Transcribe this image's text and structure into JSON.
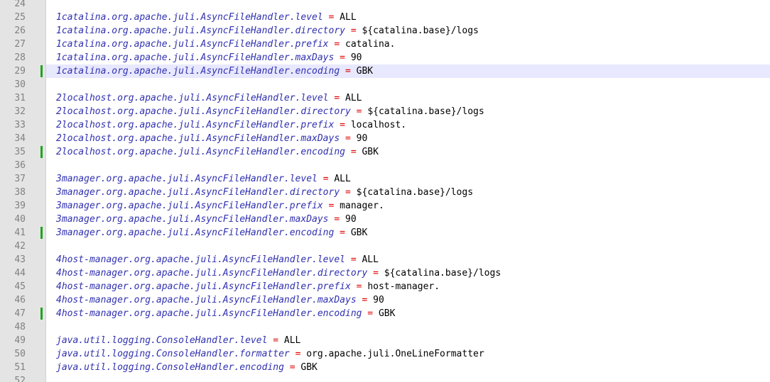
{
  "editor": {
    "language": "properties",
    "colors": {
      "gutter_bg": "#e4e4e4",
      "key": "#3030b0",
      "operator": "#e00000",
      "value": "#000000",
      "current_line": "#e8e8ff",
      "change_marker": "#1ea51e"
    },
    "current_line": 29,
    "lines": [
      {
        "num": "24",
        "key": "",
        "op": "",
        "value": "",
        "changed": false
      },
      {
        "num": "25",
        "key": "1catalina.org.apache.juli.AsyncFileHandler.level",
        "op": "=",
        "value": "ALL",
        "changed": false
      },
      {
        "num": "26",
        "key": "1catalina.org.apache.juli.AsyncFileHandler.directory",
        "op": "=",
        "value": "${catalina.base}/logs",
        "changed": false
      },
      {
        "num": "27",
        "key": "1catalina.org.apache.juli.AsyncFileHandler.prefix",
        "op": "=",
        "value": "catalina.",
        "changed": false
      },
      {
        "num": "28",
        "key": "1catalina.org.apache.juli.AsyncFileHandler.maxDays",
        "op": "=",
        "value": "90",
        "changed": false
      },
      {
        "num": "29",
        "key": "1catalina.org.apache.juli.AsyncFileHandler.encoding",
        "op": "=",
        "value": "GBK",
        "changed": true
      },
      {
        "num": "30",
        "key": "",
        "op": "",
        "value": "",
        "changed": false
      },
      {
        "num": "31",
        "key": "2localhost.org.apache.juli.AsyncFileHandler.level",
        "op": "=",
        "value": "ALL",
        "changed": false
      },
      {
        "num": "32",
        "key": "2localhost.org.apache.juli.AsyncFileHandler.directory",
        "op": "=",
        "value": "${catalina.base}/logs",
        "changed": false
      },
      {
        "num": "33",
        "key": "2localhost.org.apache.juli.AsyncFileHandler.prefix",
        "op": "=",
        "value": "localhost.",
        "changed": false
      },
      {
        "num": "34",
        "key": "2localhost.org.apache.juli.AsyncFileHandler.maxDays",
        "op": "=",
        "value": "90",
        "changed": false
      },
      {
        "num": "35",
        "key": "2localhost.org.apache.juli.AsyncFileHandler.encoding",
        "op": "=",
        "value": "GBK",
        "changed": true
      },
      {
        "num": "36",
        "key": "",
        "op": "",
        "value": "",
        "changed": false
      },
      {
        "num": "37",
        "key": "3manager.org.apache.juli.AsyncFileHandler.level",
        "op": "=",
        "value": "ALL",
        "changed": false
      },
      {
        "num": "38",
        "key": "3manager.org.apache.juli.AsyncFileHandler.directory",
        "op": "=",
        "value": "${catalina.base}/logs",
        "changed": false
      },
      {
        "num": "39",
        "key": "3manager.org.apache.juli.AsyncFileHandler.prefix",
        "op": "=",
        "value": "manager.",
        "changed": false
      },
      {
        "num": "40",
        "key": "3manager.org.apache.juli.AsyncFileHandler.maxDays",
        "op": "=",
        "value": "90",
        "changed": false
      },
      {
        "num": "41",
        "key": "3manager.org.apache.juli.AsyncFileHandler.encoding",
        "op": "=",
        "value": "GBK",
        "changed": true
      },
      {
        "num": "42",
        "key": "",
        "op": "",
        "value": "",
        "changed": false
      },
      {
        "num": "43",
        "key": "4host-manager.org.apache.juli.AsyncFileHandler.level",
        "op": "=",
        "value": "ALL",
        "changed": false
      },
      {
        "num": "44",
        "key": "4host-manager.org.apache.juli.AsyncFileHandler.directory",
        "op": "=",
        "value": "${catalina.base}/logs",
        "changed": false
      },
      {
        "num": "45",
        "key": "4host-manager.org.apache.juli.AsyncFileHandler.prefix",
        "op": "=",
        "value": "host-manager.",
        "changed": false
      },
      {
        "num": "46",
        "key": "4host-manager.org.apache.juli.AsyncFileHandler.maxDays",
        "op": "=",
        "value": "90",
        "changed": false
      },
      {
        "num": "47",
        "key": "4host-manager.org.apache.juli.AsyncFileHandler.encoding",
        "op": "=",
        "value": "GBK",
        "changed": true
      },
      {
        "num": "48",
        "key": "",
        "op": "",
        "value": "",
        "changed": false
      },
      {
        "num": "49",
        "key": "java.util.logging.ConsoleHandler.level",
        "op": "=",
        "value": "ALL",
        "changed": false
      },
      {
        "num": "50",
        "key": "java.util.logging.ConsoleHandler.formatter",
        "op": "=",
        "value": "org.apache.juli.OneLineFormatter",
        "changed": false
      },
      {
        "num": "51",
        "key": "java.util.logging.ConsoleHandler.encoding",
        "op": "=",
        "value": "GBK",
        "changed": false
      },
      {
        "num": "52",
        "key": "",
        "op": "",
        "value": "",
        "changed": false
      }
    ]
  }
}
